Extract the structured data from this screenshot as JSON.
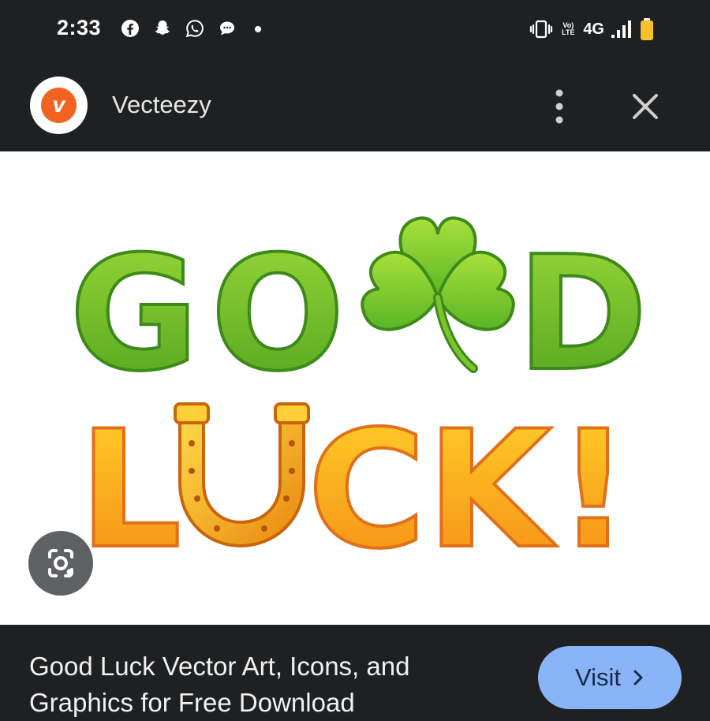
{
  "status_bar": {
    "time": "2:33",
    "notification_icons": [
      "facebook-icon",
      "snapchat-icon",
      "whatsapp-icon",
      "message-bubble-icon",
      "dot-icon"
    ],
    "volte": "Vo) LTE",
    "network": "4G",
    "battery_color": "#f9c02e"
  },
  "header": {
    "site_name": "Vecteezy",
    "logo_letter": "v",
    "logo_color": "#f26322"
  },
  "image": {
    "line1": "GOOD",
    "line2": "LUCK!",
    "green": "#6cc22a",
    "orange": "#f7a21b"
  },
  "footer": {
    "caption": "Good Luck Vector Art, Icons, and Graphics for Free Download",
    "visit_label": "Visit"
  },
  "colors": {
    "background": "#1f2022",
    "visit_button": "#8ab4f8"
  }
}
